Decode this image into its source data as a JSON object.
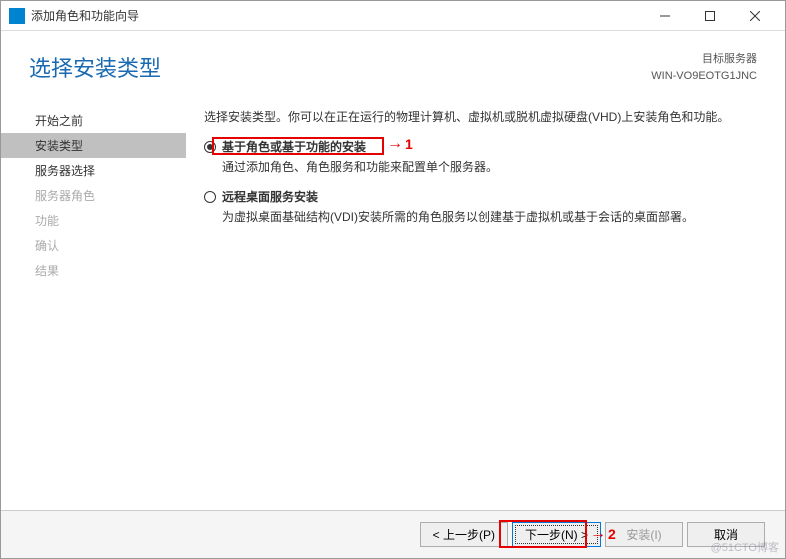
{
  "window": {
    "title": "添加角色和功能向导"
  },
  "header": {
    "page_title": "选择安装类型",
    "server_label": "目标服务器",
    "server_name": "WIN-VO9EOTG1JNC"
  },
  "sidebar": {
    "items": [
      {
        "label": "开始之前",
        "state": "enabled"
      },
      {
        "label": "安装类型",
        "state": "selected"
      },
      {
        "label": "服务器选择",
        "state": "enabled"
      },
      {
        "label": "服务器角色",
        "state": "disabled"
      },
      {
        "label": "功能",
        "state": "disabled"
      },
      {
        "label": "确认",
        "state": "disabled"
      },
      {
        "label": "结果",
        "state": "disabled"
      }
    ]
  },
  "main": {
    "description": "选择安装类型。你可以在正在运行的物理计算机、虚拟机或脱机虚拟硬盘(VHD)上安装角色和功能。",
    "options": [
      {
        "label": "基于角色或基于功能的安装",
        "description": "通过添加角色、角色服务和功能来配置单个服务器。",
        "checked": true
      },
      {
        "label": "远程桌面服务安装",
        "description": "为虚拟桌面基础结构(VDI)安装所需的角色服务以创建基于虚拟机或基于会话的桌面部署。",
        "checked": false
      }
    ]
  },
  "annotations": {
    "arrow1": "1",
    "arrow2": "2"
  },
  "footer": {
    "prev": "< 上一步(P)",
    "next": "下一步(N) >",
    "install": "安装(I)",
    "cancel": "取消"
  },
  "watermark": "@51CTO博客"
}
